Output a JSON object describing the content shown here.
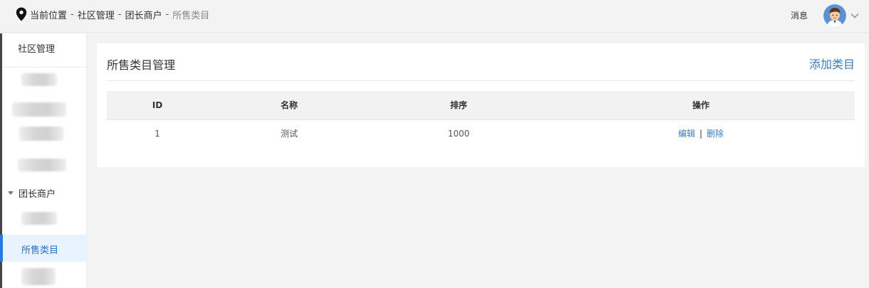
{
  "header": {
    "location_label": "当前位置",
    "breadcrumbs": [
      "社区管理",
      "团长商户",
      "所售类目"
    ],
    "separator": "-",
    "messages_label": "消息"
  },
  "sidebar": {
    "title": "社区管理",
    "group": {
      "label": "团长商户",
      "expanded": true
    },
    "active_item": "所售类目"
  },
  "main": {
    "title": "所售类目管理",
    "add_button": "添加类目",
    "table": {
      "columns": [
        "ID",
        "名称",
        "排序",
        "操作"
      ],
      "rows": [
        {
          "id": "1",
          "name": "测试",
          "sort": "1000",
          "edit": "编辑",
          "separator": "|",
          "delete": "删除"
        }
      ]
    }
  },
  "colors": {
    "accent": "#2b78e4",
    "link": "#3b7bbf",
    "active_bg": "#e8f3fd"
  },
  "icons": [
    "location-pin-icon",
    "avatar",
    "chevron-down-icon",
    "caret-down-icon"
  ]
}
